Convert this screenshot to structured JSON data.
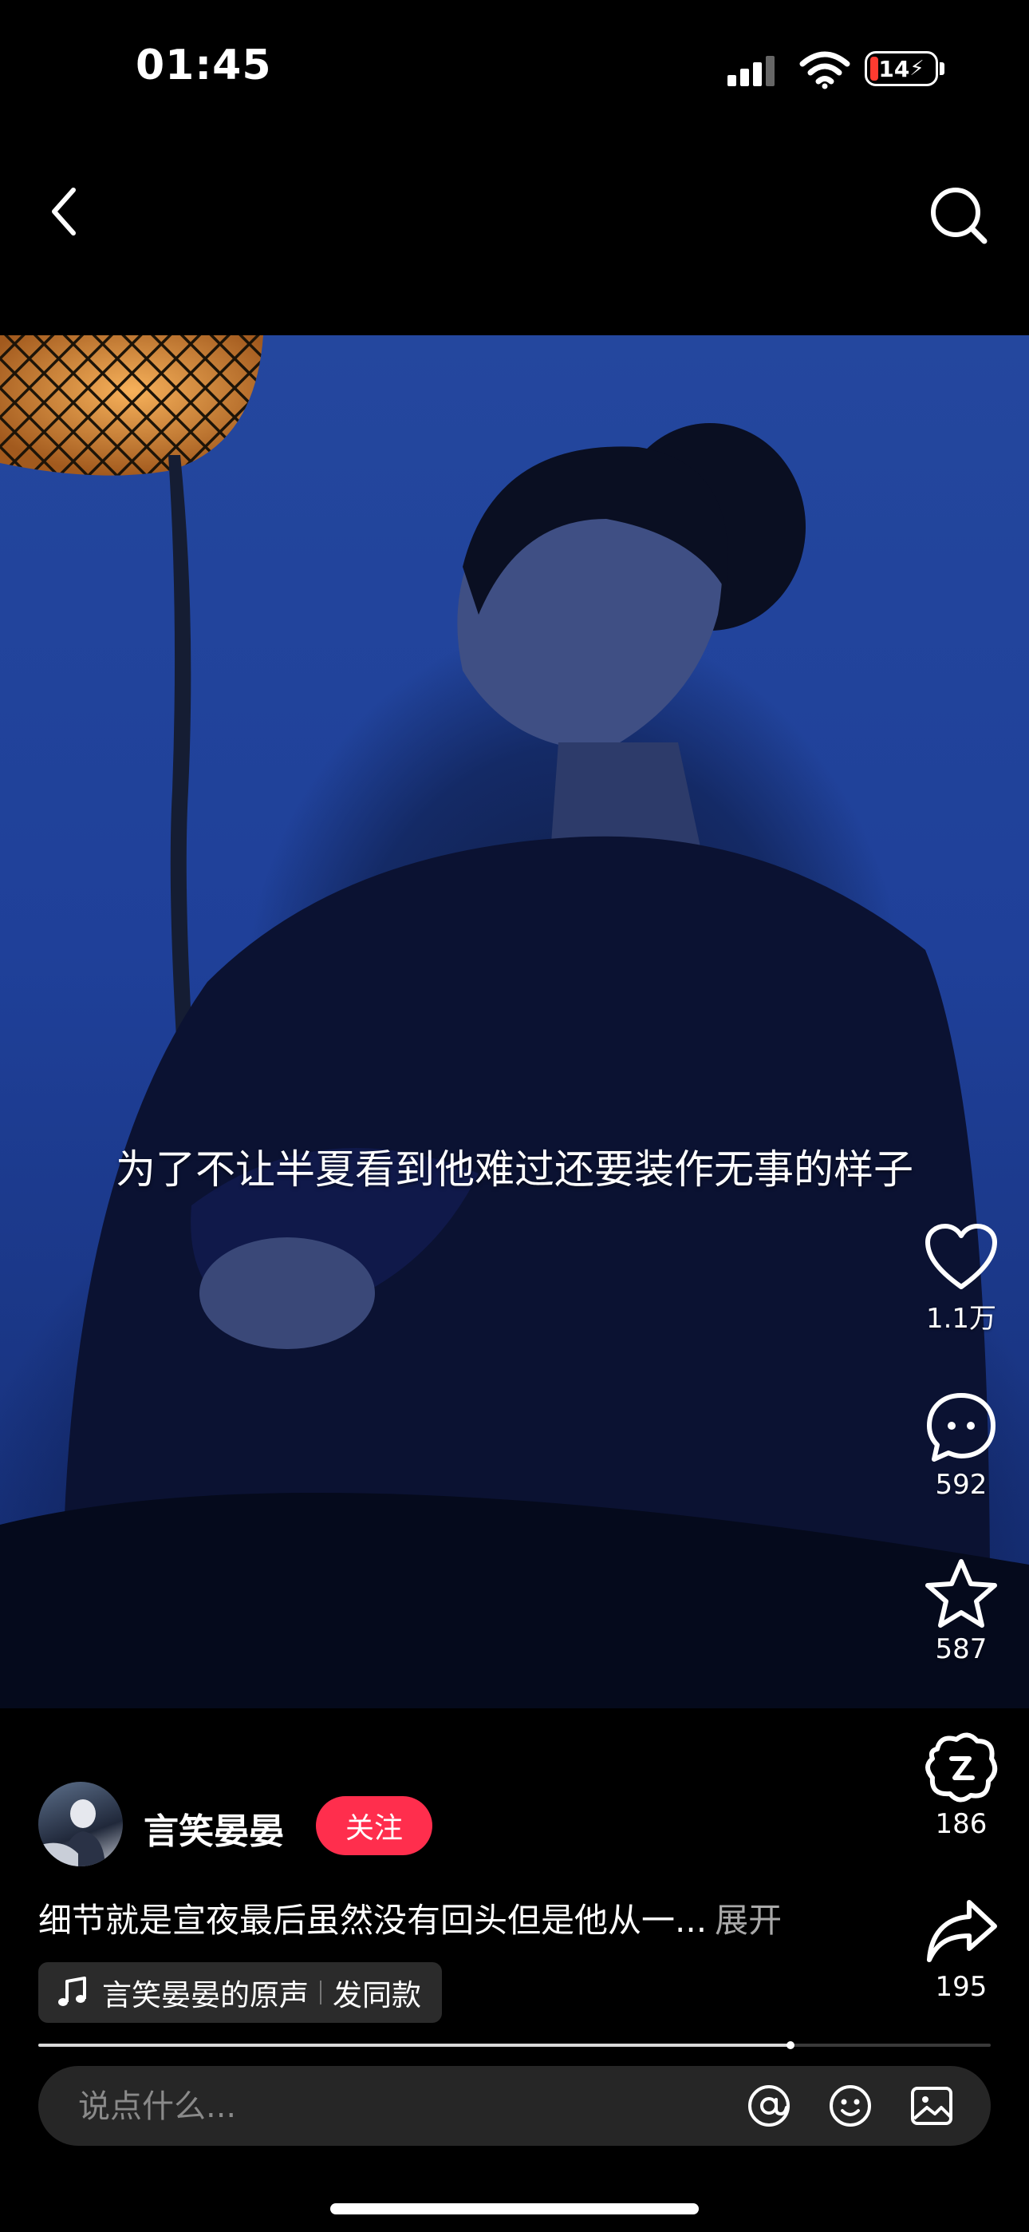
{
  "status_bar": {
    "time": "01:45",
    "battery": "14"
  },
  "video": {
    "subtitle": "为了不让半夏看到他难过还要装作无事的样子"
  },
  "actions": {
    "like_count": "1.1万",
    "comment_count": "592",
    "favorite_count": "587",
    "gift_count": "186",
    "share_count": "195"
  },
  "author": {
    "name": "言笑晏晏",
    "follow_label": "关注"
  },
  "post": {
    "caption": "细节就是宣夜最后虽然没有回头但是他从一...",
    "expand_label": "展开",
    "music_label": "言笑晏晏的原声",
    "same_style_label": "发同款"
  },
  "progress": {
    "fraction": 0.79
  },
  "comment": {
    "placeholder": "说点什么..."
  },
  "colors": {
    "accent": "#ff2e4d",
    "background": "#000000",
    "video_blue": "#1f4099"
  }
}
